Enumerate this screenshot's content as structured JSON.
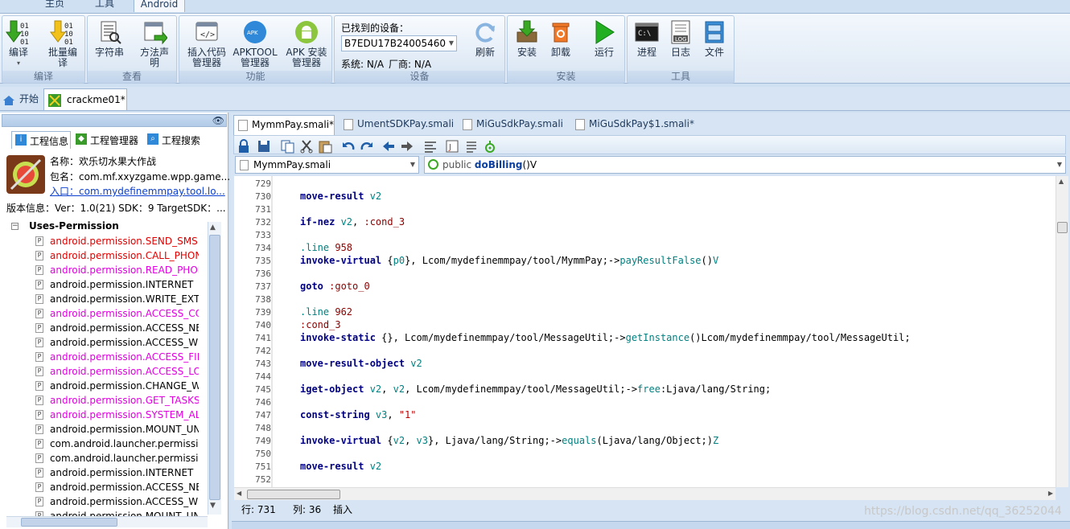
{
  "menu_tabs": [
    "主页",
    "工具",
    "Android"
  ],
  "ribbon": {
    "groups": [
      {
        "title": "编译",
        "buttons": [
          "编译",
          "批量编译"
        ]
      },
      {
        "title": "查看",
        "buttons": [
          "字符串",
          "方法声明"
        ]
      },
      {
        "title": "功能",
        "buttons": [
          "插入代码管理器",
          "APKTOOL管理器",
          "APK 安装管理器"
        ]
      },
      {
        "title": "设备",
        "found_label": "已找到的设备：",
        "device": "B7EDU17B24005460",
        "system": "系统: N/A",
        "vendor": "厂商: N/A",
        "refresh": "刷新"
      },
      {
        "title": "安装",
        "buttons": [
          "安装",
          "卸载",
          "运行"
        ]
      },
      {
        "title": "工具",
        "buttons": [
          "进程",
          "日志",
          "文件"
        ]
      }
    ]
  },
  "doc_tabs": [
    "开始",
    "crackme01*"
  ],
  "left": {
    "tabs": [
      "工程信息",
      "工程管理器",
      "工程搜索"
    ],
    "app_name": "名称：欢乐切水果大作战",
    "package": "包名：com.mf.xxyzgame.wpp.game...",
    "entry": "入口：com.mydefinemmpay.tool.lo...",
    "version": "版本信息：Ver：1.0(21) SDK：9 TargetSDK：...",
    "tree_root": "Uses-Permission",
    "permissions": [
      {
        "text": "android.permission.SEND_SMS",
        "color": "#e00000"
      },
      {
        "text": "android.permission.CALL_PHONE",
        "color": "#e00000"
      },
      {
        "text": "android.permission.READ_PHONE_STATE",
        "color": "#e000e0"
      },
      {
        "text": "android.permission.INTERNET",
        "color": "#000000"
      },
      {
        "text": "android.permission.WRITE_EXTERNAL_STORAGE",
        "color": "#000000"
      },
      {
        "text": "android.permission.ACCESS_COARSE_LOCATION",
        "color": "#e000e0"
      },
      {
        "text": "android.permission.ACCESS_NETWORK_STATE",
        "color": "#000000"
      },
      {
        "text": "android.permission.ACCESS_WIFI_STATE",
        "color": "#000000"
      },
      {
        "text": "android.permission.ACCESS_FINE_LOCATION",
        "color": "#e000e0"
      },
      {
        "text": "android.permission.ACCESS_LOCATION_EXTRA_COMMANDS",
        "color": "#e000e0"
      },
      {
        "text": "android.permission.CHANGE_WIFI_STATE",
        "color": "#000000"
      },
      {
        "text": "android.permission.GET_TASKS",
        "color": "#e000e0"
      },
      {
        "text": "android.permission.SYSTEM_ALERT_WINDOW",
        "color": "#e000e0"
      },
      {
        "text": "android.permission.MOUNT_UNMOUNT_FILESYSTEMS",
        "color": "#000000"
      },
      {
        "text": "com.android.launcher.permission.INSTALL_SHORTCUT",
        "color": "#000000"
      },
      {
        "text": "com.android.launcher.permission.UNINSTALL_SHORTCUT",
        "color": "#000000"
      },
      {
        "text": "android.permission.INTERNET",
        "color": "#000000"
      },
      {
        "text": "android.permission.ACCESS_NETWORK_STATE",
        "color": "#000000"
      },
      {
        "text": "android.permission.ACCESS_WIFI_STATE",
        "color": "#000000"
      },
      {
        "text": "android.permission.MOUNT_UNMOUNT_FILESYSTEMS",
        "color": "#000000"
      }
    ]
  },
  "editor": {
    "tabs": [
      "MymmPay.smali*",
      "UmentSDKPay.smali",
      "MiGuSdkPay.smali",
      "MiGuSdkPay$1.smali*"
    ],
    "class_select": "MymmPay.smali",
    "method_select_prefix": "public ",
    "method_select_name": "doBilling",
    "method_select_suffix": "()V",
    "lines": [
      {
        "n": "729",
        "t": []
      },
      {
        "n": "730",
        "t": [
          [
            "kw",
            "move-result "
          ],
          [
            "reg",
            "v2"
          ]
        ]
      },
      {
        "n": "731",
        "t": []
      },
      {
        "n": "732",
        "t": [
          [
            "kw",
            "if-nez "
          ],
          [
            "reg",
            "v2"
          ],
          [
            "plain",
            ", "
          ],
          [
            "lbl",
            ":cond_3"
          ]
        ]
      },
      {
        "n": "733",
        "t": []
      },
      {
        "n": "734",
        "t": [
          [
            "reg",
            ".line "
          ],
          [
            "lbl",
            "958"
          ]
        ]
      },
      {
        "n": "735",
        "t": [
          [
            "kw",
            "invoke-virtual "
          ],
          [
            "plain",
            "{"
          ],
          [
            "reg",
            "p0"
          ],
          [
            "plain",
            "}, Lcom/mydefinemmpay/tool/MymmPay;->"
          ],
          [
            "meth",
            "payResultFalse"
          ],
          [
            "plain",
            "()"
          ],
          [
            "reg",
            "V"
          ]
        ]
      },
      {
        "n": "736",
        "t": []
      },
      {
        "n": "737",
        "t": [
          [
            "kw",
            "goto "
          ],
          [
            "lbl",
            ":goto_0"
          ]
        ]
      },
      {
        "n": "738",
        "t": []
      },
      {
        "n": "739",
        "t": [
          [
            "reg",
            ".line "
          ],
          [
            "lbl",
            "962"
          ]
        ]
      },
      {
        "n": "740",
        "t": [
          [
            "lbl",
            ":cond_3"
          ]
        ]
      },
      {
        "n": "741",
        "t": [
          [
            "kw",
            "invoke-static "
          ],
          [
            "plain",
            "{}, Lcom/mydefinemmpay/tool/MessageUtil;->"
          ],
          [
            "meth",
            "getInstance"
          ],
          [
            "plain",
            "()Lcom/mydefinemmpay/tool/MessageUtil;"
          ]
        ]
      },
      {
        "n": "742",
        "t": []
      },
      {
        "n": "743",
        "t": [
          [
            "kw",
            "move-result-object "
          ],
          [
            "reg",
            "v2"
          ]
        ]
      },
      {
        "n": "744",
        "t": []
      },
      {
        "n": "745",
        "t": [
          [
            "kw",
            "iget-object "
          ],
          [
            "reg",
            "v2"
          ],
          [
            "plain",
            ", "
          ],
          [
            "reg",
            "v2"
          ],
          [
            "plain",
            ", Lcom/mydefinemmpay/tool/MessageUtil;->"
          ],
          [
            "meth",
            "free"
          ],
          [
            "plain",
            ":Ljava/lang/String;"
          ]
        ]
      },
      {
        "n": "746",
        "t": []
      },
      {
        "n": "747",
        "t": [
          [
            "kw",
            "const-string "
          ],
          [
            "reg",
            "v3"
          ],
          [
            "plain",
            ", "
          ],
          [
            "str",
            "\"1\""
          ]
        ]
      },
      {
        "n": "748",
        "t": []
      },
      {
        "n": "749",
        "t": [
          [
            "kw",
            "invoke-virtual "
          ],
          [
            "plain",
            "{"
          ],
          [
            "reg",
            "v2"
          ],
          [
            "plain",
            ", "
          ],
          [
            "reg",
            "v3"
          ],
          [
            "plain",
            "}, Ljava/lang/String;->"
          ],
          [
            "meth",
            "equals"
          ],
          [
            "plain",
            "(Ljava/lang/Object;)"
          ],
          [
            "reg",
            "Z"
          ]
        ]
      },
      {
        "n": "750",
        "t": []
      },
      {
        "n": "751",
        "t": [
          [
            "kw",
            "move-result "
          ],
          [
            "reg",
            "v2"
          ]
        ]
      },
      {
        "n": "752",
        "t": []
      }
    ]
  },
  "status": {
    "row": "行: 731",
    "col": "列: 36",
    "mode": "插入"
  },
  "watermark": "https://blog.csdn.net/qq_36252044"
}
